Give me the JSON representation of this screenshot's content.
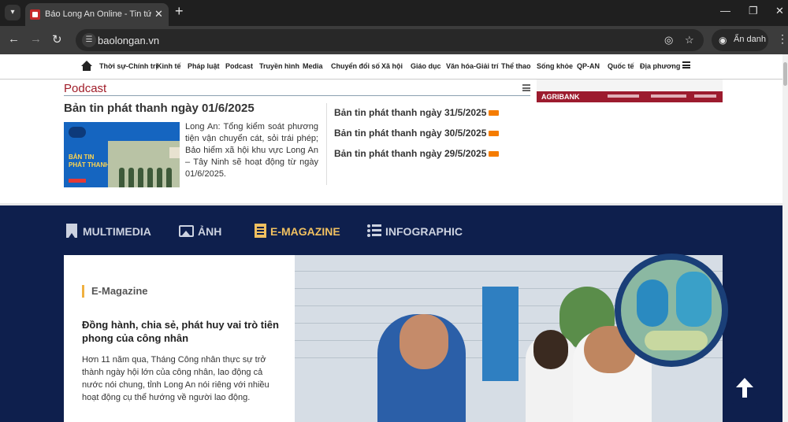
{
  "browser": {
    "tab_title": "Báo Long An Online - Tin tức Lo",
    "url": "baolongan.vn",
    "incognito_label": "Ẩn danh",
    "icons": [
      "tab-search-icon",
      "favicon",
      "close-icon",
      "plus-icon",
      "minimize-icon",
      "restore-icon",
      "window-close-icon",
      "back-icon",
      "forward-icon",
      "reload-icon",
      "site-info-icon",
      "eye-off-icon",
      "star-icon",
      "incognito-icon",
      "kebab-menu-icon"
    ]
  },
  "topnav": {
    "items": [
      "Thời sự-Chính trị",
      "Kinh tế",
      "Pháp luật",
      "Podcast",
      "Truyền hình",
      "Media",
      "Chuyển đổi số",
      "Xã hội",
      "Giáo dục",
      "Văn hóa-Giải trí",
      "Thể thao",
      "Sống khỏe",
      "QP-AN",
      "Quốc tế",
      "Địa phương"
    ]
  },
  "ad": {
    "brand": "AGRIBANK"
  },
  "podcast": {
    "section_title": "Podcast",
    "main_title": "Bản tin phát thanh ngày 01/6/2025",
    "thumb_text_1": "BẢN TIN",
    "thumb_text_2": "PHÁT THANH",
    "description": "Long An: Tổng kiểm soát phương tiện vận chuyển cát, sỏi trái phép; Bảo hiểm xã hội khu vực Long An – Tây Ninh sẽ hoạt động từ ngày 01/6/2025.",
    "side_items": [
      "Bản tin phát thanh ngày 31/5/2025",
      "Bản tin phát thanh ngày 30/5/2025",
      "Bản tin phát thanh ngày 29/5/2025"
    ]
  },
  "media_section": {
    "tabs": [
      "MULTIMEDIA",
      "ẢNH",
      "E-MAGAZINE",
      "INFOGRAPHIC"
    ],
    "active_tab": "E-MAGAZINE",
    "active_color": "#f0c060",
    "background_color": "#0e1f4d"
  },
  "emagazine": {
    "tag": "E-Magazine",
    "title": "Đồng hành, chia sẻ, phát huy vai trò tiên phong của công nhân",
    "description": "Hơn 11 năm qua, Tháng Công nhân thực sự trở thành ngày hội lớn của công nhân, lao động cả nước nói chung, tỉnh Long An nói riêng với nhiều hoạt động cụ thể hướng về người lao động."
  }
}
